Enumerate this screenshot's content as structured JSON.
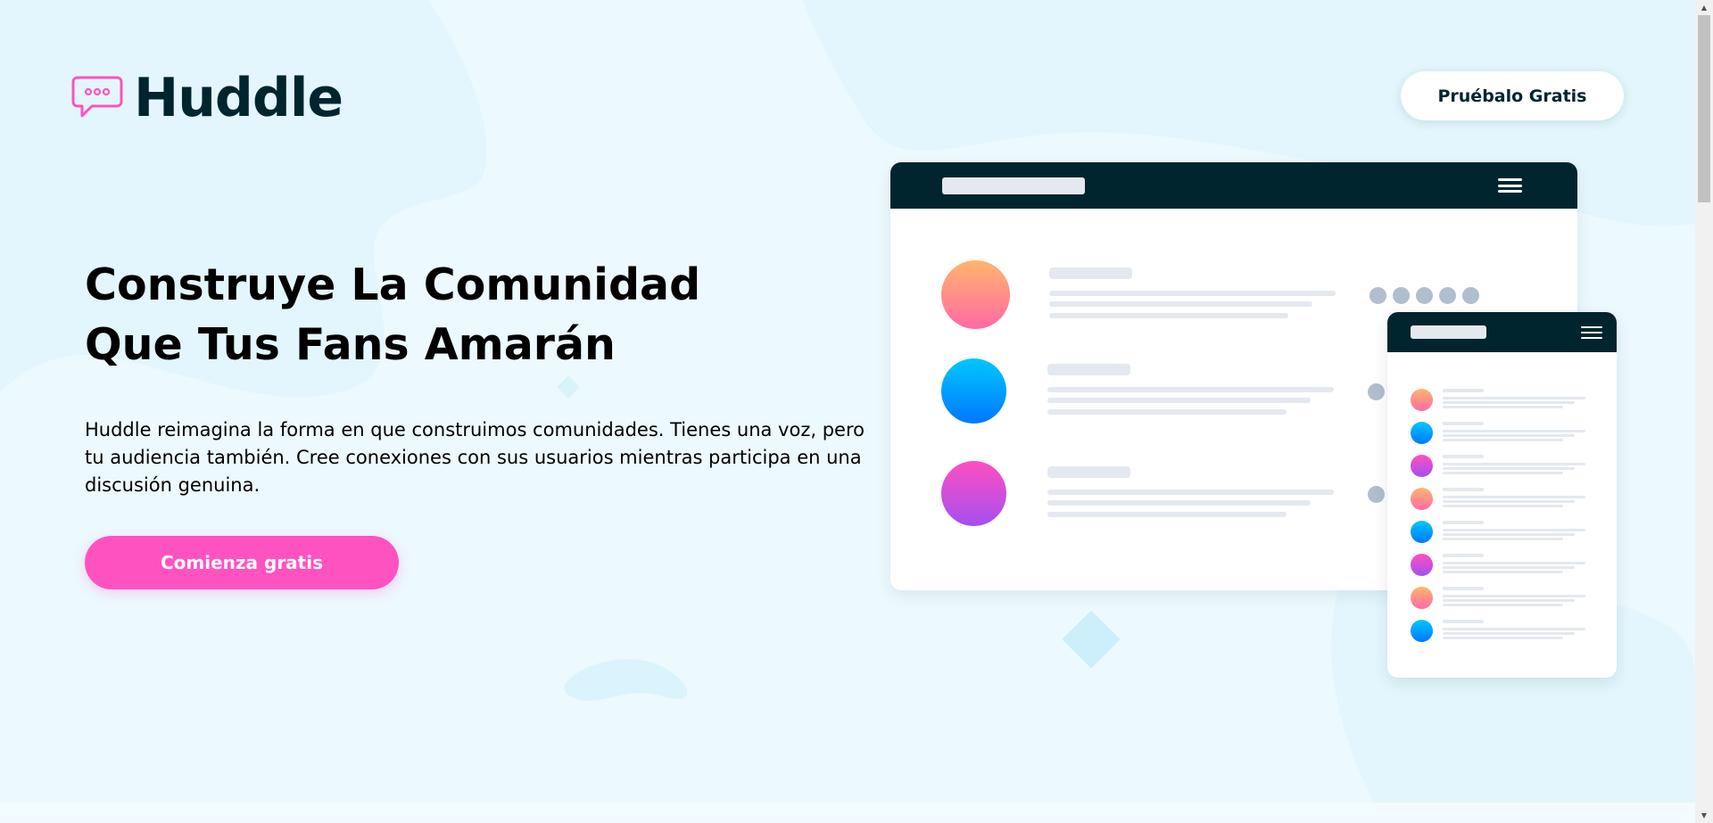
{
  "header": {
    "logo_text": "Huddle",
    "try_button_label": "Pruébalo Gratis"
  },
  "hero": {
    "headline": "Construye La Comunidad Que Tus Fans Amarán",
    "description": "Huddle reimagina la forma en que construimos comunidades. Tienes una voz, pero tu audiencia también. Cree conexiones con sus usuarios mientras participa en una discusión genuina.",
    "cta_label": "Comienza gratis"
  },
  "mockup": {
    "desktop_avatars": [
      "orange-pink",
      "blue",
      "pink-purple"
    ],
    "mobile_avatars": [
      "orange-pink",
      "blue",
      "pink-purple",
      "orange-pink",
      "blue",
      "pink-purple",
      "orange-pink",
      "blue"
    ]
  },
  "colors": {
    "brand_dark": "#00252e",
    "accent_pink": "#ff52c1",
    "background": "#ecf9fe",
    "placeholder": "#e4e9ef",
    "dot": "#afbfce"
  },
  "icons": {
    "logo": "chat-bubble-icon",
    "menu": "hamburger-menu-icon"
  }
}
